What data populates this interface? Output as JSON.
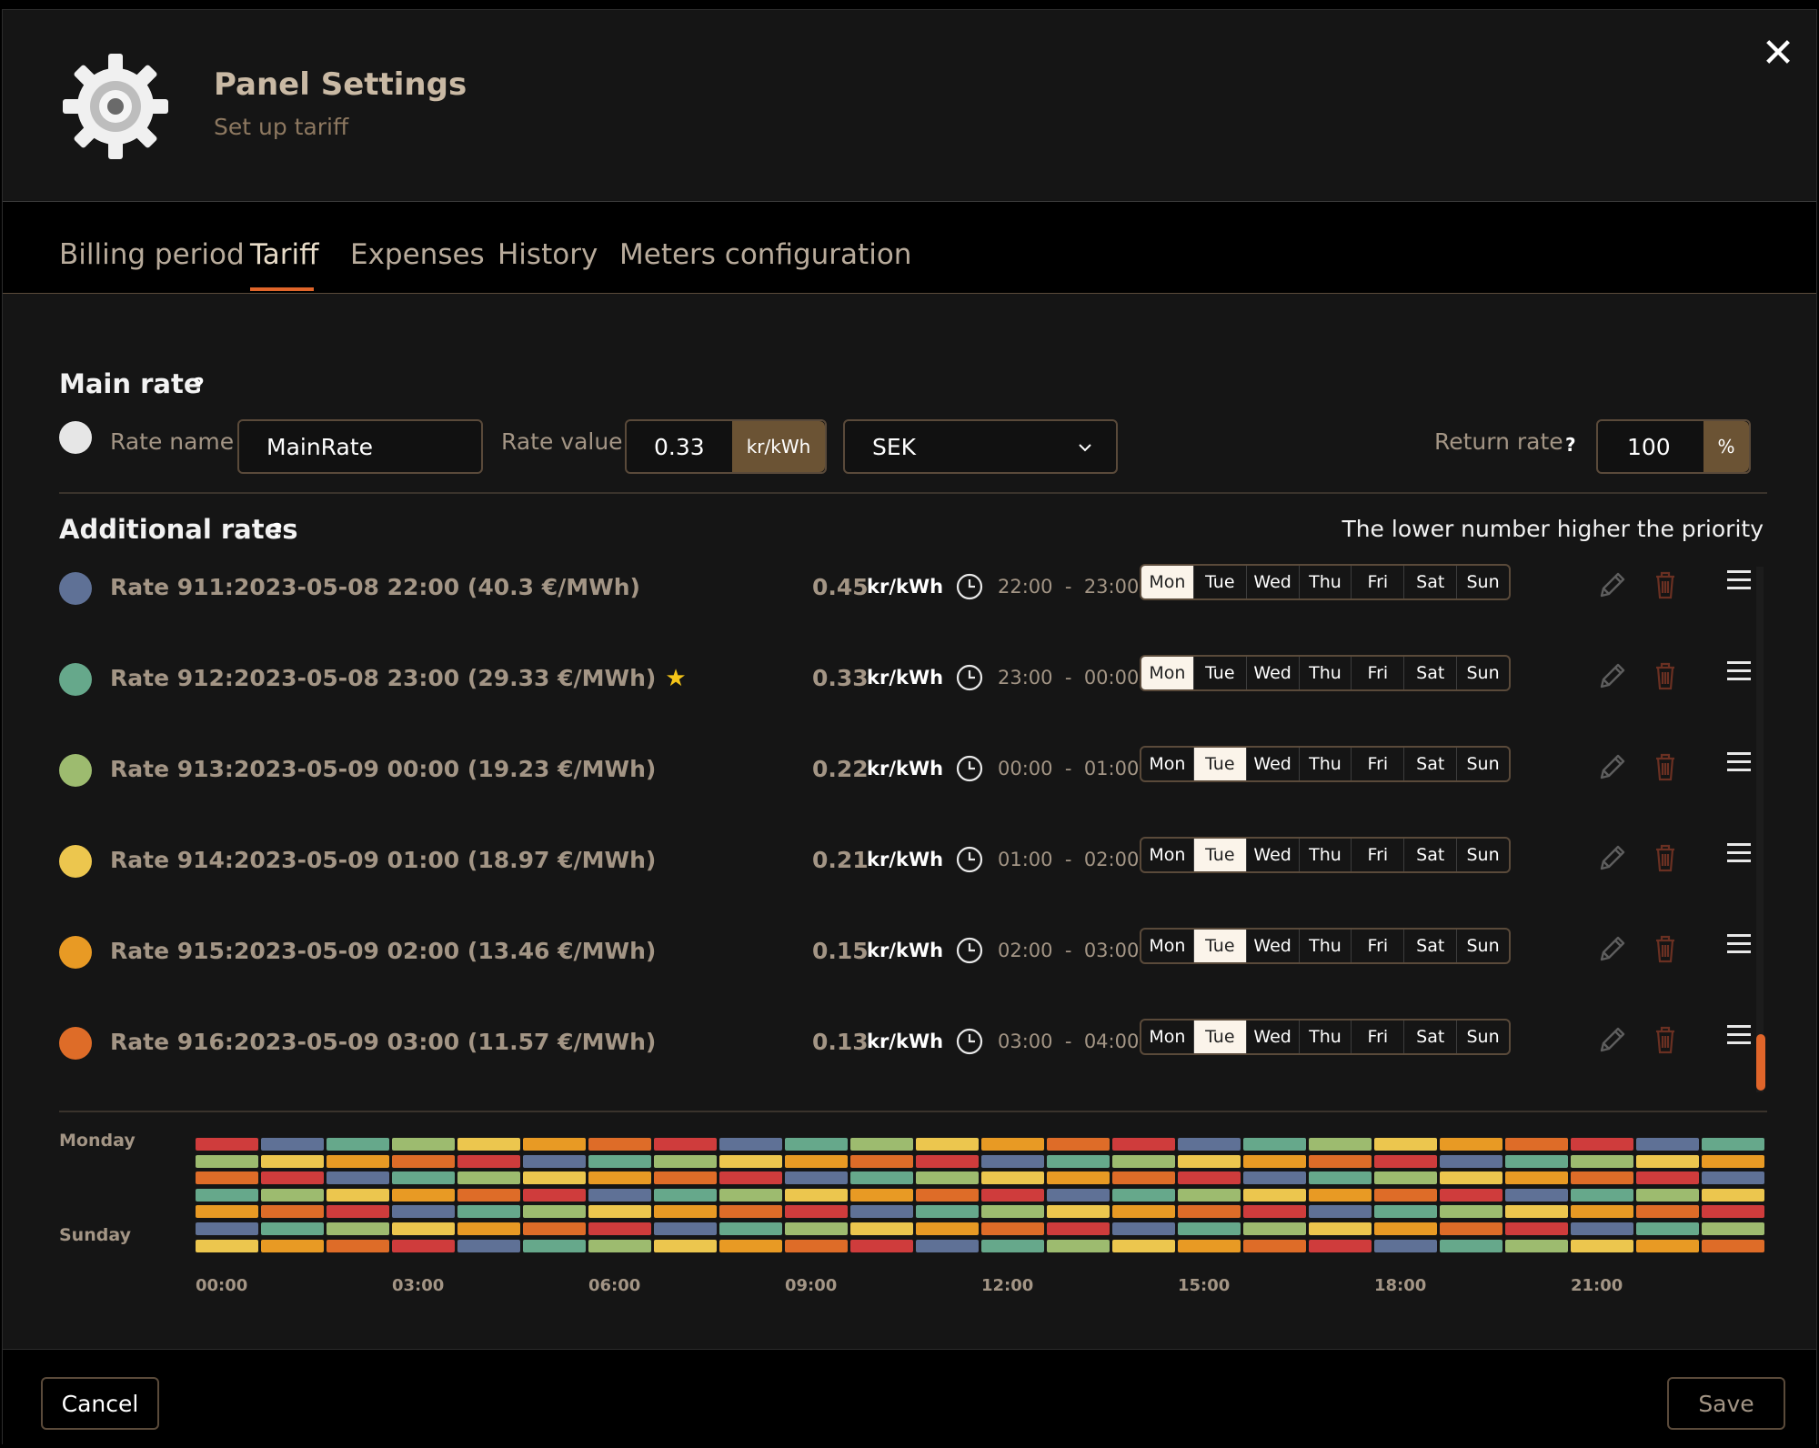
{
  "header": {
    "title": "Panel Settings",
    "subtitle": "Set up tariff",
    "close_label": "✕"
  },
  "tabs": [
    {
      "label": "Billing period"
    },
    {
      "label": "Tariff"
    },
    {
      "label": "Expenses"
    },
    {
      "label": "History"
    },
    {
      "label": "Meters configuration"
    }
  ],
  "active_tab": "Tariff",
  "main_rate": {
    "title": "Main rate",
    "help": "?",
    "color": "#e6e6e6",
    "name_label": "Rate name",
    "name_value": "MainRate",
    "value_label": "Rate value",
    "value": "0.33",
    "value_unit": "kr/kWh",
    "currency": "SEK",
    "return_label": "Return rate",
    "return_help": "?",
    "return_value": "100",
    "return_unit": "%"
  },
  "additional_rates": {
    "title": "Additional rates",
    "help": "?",
    "priority_note": "The lower number higher the priority",
    "day_names": [
      "Mon",
      "Tue",
      "Wed",
      "Thu",
      "Fri",
      "Sat",
      "Sun"
    ],
    "items": [
      {
        "name": "Rate 911:",
        "desc": "2023-05-08 22:00 (40.3 €/MWh)",
        "value": "0.45",
        "unit": "kr/kWh",
        "start": "22:00",
        "end": "23:00",
        "color": "#5f7196",
        "starred": false,
        "active_days": [
          "Mon"
        ]
      },
      {
        "name": "Rate 912:",
        "desc": "2023-05-08 23:00 (29.33 €/MWh)",
        "value": "0.33",
        "unit": "kr/kWh",
        "start": "23:00",
        "end": "00:00",
        "color": "#66a88b",
        "starred": true,
        "active_days": [
          "Mon"
        ]
      },
      {
        "name": "Rate 913:",
        "desc": "2023-05-09 00:00 (19.23 €/MWh)",
        "value": "0.22",
        "unit": "kr/kWh",
        "start": "00:00",
        "end": "01:00",
        "color": "#9dbb6f",
        "starred": false,
        "active_days": [
          "Tue"
        ]
      },
      {
        "name": "Rate 914:",
        "desc": "2023-05-09 01:00 (18.97 €/MWh)",
        "value": "0.21",
        "unit": "kr/kWh",
        "start": "01:00",
        "end": "02:00",
        "color": "#ecc64e",
        "starred": false,
        "active_days": [
          "Tue"
        ]
      },
      {
        "name": "Rate 915:",
        "desc": "2023-05-09 02:00 (13.46 €/MWh)",
        "value": "0.15",
        "unit": "kr/kWh",
        "start": "02:00",
        "end": "03:00",
        "color": "#e89a24",
        "starred": false,
        "active_days": [
          "Tue"
        ]
      },
      {
        "name": "Rate 916:",
        "desc": "2023-05-09 03:00 (11.57 €/MWh)",
        "value": "0.13",
        "unit": "kr/kWh",
        "start": "03:00",
        "end": "04:00",
        "color": "#de6c28",
        "starred": false,
        "active_days": [
          "Tue"
        ]
      }
    ]
  },
  "schedule": {
    "row_labels": [
      "Monday",
      "Sunday"
    ],
    "hour_ticks": [
      "00:00",
      "03:00",
      "06:00",
      "09:00",
      "12:00",
      "15:00",
      "18:00",
      "21:00"
    ],
    "palette": [
      "#cf3c3c",
      "#5f7196",
      "#66a88b",
      "#9dbb6f",
      "#ecc64e",
      "#e89a24",
      "#de6c28"
    ]
  },
  "footer": {
    "cancel_label": "Cancel",
    "save_label": "Save"
  }
}
